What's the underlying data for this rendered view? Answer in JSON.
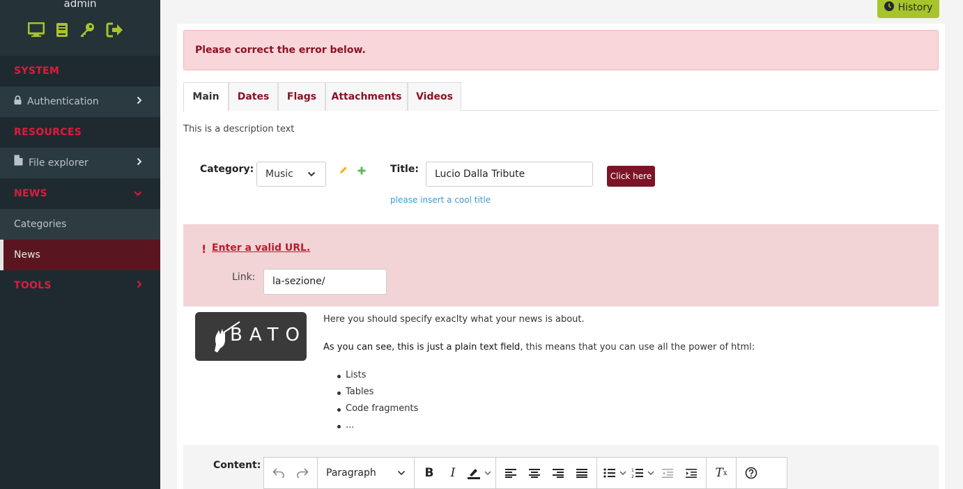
{
  "sidebar": {
    "username": "admin",
    "sections": {
      "system": "SYSTEM",
      "resources": "RESOURCES",
      "news": "NEWS",
      "tools": "TOOLS"
    },
    "items": {
      "authentication": "Authentication",
      "file_explorer": "File explorer",
      "categories": "Categories",
      "news": "News"
    },
    "icons": [
      "monitor-icon",
      "book-icon",
      "key-icon",
      "logout-icon"
    ]
  },
  "header": {
    "history_label": "History"
  },
  "form": {
    "error_banner": "Please correct the error below.",
    "tabs": [
      "Main",
      "Dates",
      "Flags",
      "Attachments",
      "Videos"
    ],
    "description": "This is a description text",
    "category_label": "Category:",
    "category_value": "Music",
    "title_label": "Title:",
    "title_value": "Lucio Dalla Tribute",
    "title_help": "please insert a cool title",
    "click_button": "Click here",
    "link_error": "Enter a valid URL.",
    "link_label": "Link:",
    "link_value": "la-sezione/",
    "logo_text": "BATON",
    "info_p1": "Here you should specify exaclty what your news is about.",
    "info_p2_bold": "As you can see, this is just a plain text field",
    "info_p2_rest": ", this means that you can use all the power of html:",
    "info_list": [
      "Lists",
      "Tables",
      "Code fragments",
      "..."
    ],
    "content_label": "Content:",
    "editor": {
      "block_format": "Paragraph"
    }
  },
  "colors": {
    "sidebar_bg": "#1f2a30",
    "accent_red": "#e01a3c",
    "lime": "#a8c42b",
    "dark_red": "#7a1426"
  }
}
